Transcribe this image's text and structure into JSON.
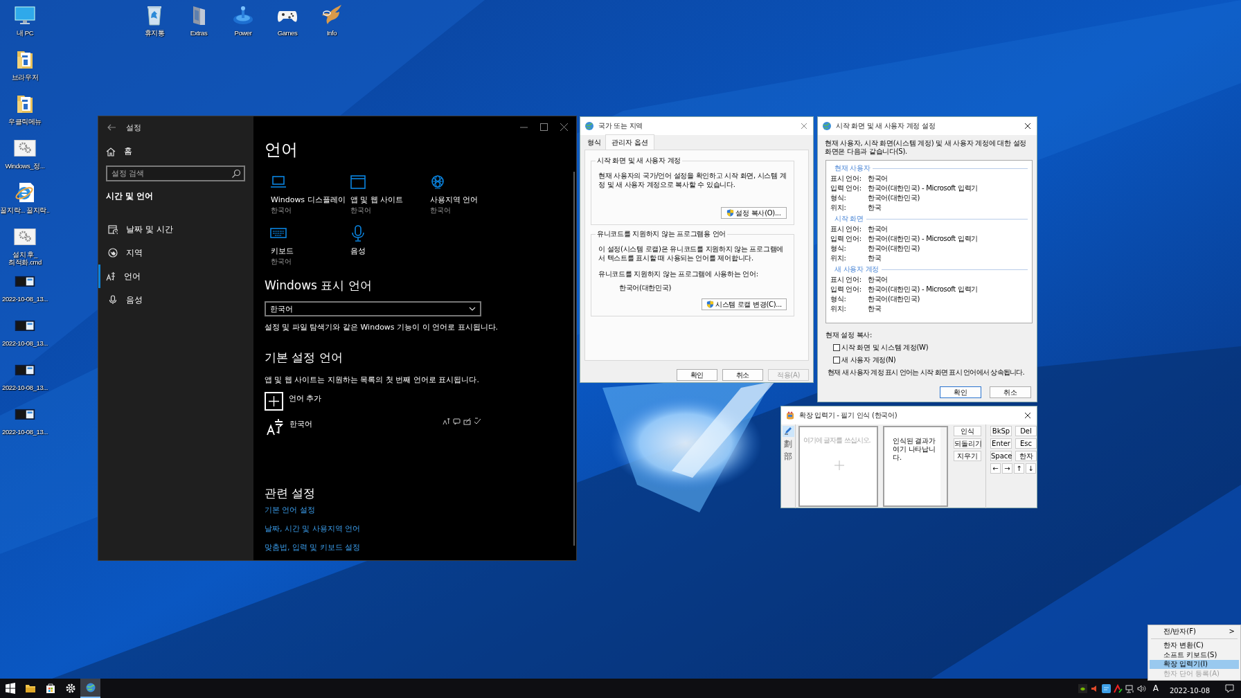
{
  "desktop_column": [
    {
      "label": "내 PC"
    },
    {
      "label": "브라우저"
    },
    {
      "label": "우클릭메뉴"
    },
    {
      "label": "Windows_정..."
    },
    {
      "label": "꿀지락... 꿀지락.."
    },
    {
      "label": "설치 후_최적화.cmd"
    },
    {
      "label": "2022-10-08_13..."
    },
    {
      "label": "2022-10-08_13..."
    },
    {
      "label": "2022-10-08_13..."
    },
    {
      "label": "2022-10-08_13..."
    }
  ],
  "desktop_row": [
    {
      "label": "휴지통"
    },
    {
      "label": "Extras"
    },
    {
      "label": "Power"
    },
    {
      "label": "Games"
    },
    {
      "label": "Info"
    }
  ],
  "settings": {
    "title": "설정",
    "home": "홈",
    "search_placeholder": "설정 검색",
    "section": "시간 및 언어",
    "nav": [
      {
        "label": "날짜 및 시간",
        "selected": false
      },
      {
        "label": "지역",
        "selected": false
      },
      {
        "label": "언어",
        "selected": true
      },
      {
        "label": "음성",
        "selected": false
      }
    ],
    "heading": "언어",
    "tiles": [
      {
        "title": "Windows 디스플레이",
        "subtitle": "한국어"
      },
      {
        "title": "앱 및 웹 사이트",
        "subtitle": "한국어"
      },
      {
        "title": "사용지역 언어",
        "subtitle": "한국어"
      },
      {
        "title": "키보드",
        "subtitle": "한국어"
      },
      {
        "title": "음성"
      }
    ],
    "display_language": {
      "heading": "Windows 표시 언어",
      "value": "한국어",
      "note": "설정 및 파일 탐색기와 같은 Windows 기능이 이 언어로 표시됩니다."
    },
    "preferred": {
      "heading": "기본 설정 언어",
      "note": "앱 및 웹 사이트는 지원하는 목록의 첫 번째 언어로 표시됩니다.",
      "add": "언어 추가",
      "languages": [
        {
          "name": "한국어"
        }
      ]
    },
    "related": {
      "heading": "관련 설정",
      "links": [
        "기본 언어 설정",
        "날짜, 시간 및 사용지역 언어",
        "맞춤법, 입력 및 키보드 설정"
      ]
    }
  },
  "region_dialog": {
    "title": "국가 또는 지역",
    "tabs": [
      {
        "label": "형식",
        "selected": false
      },
      {
        "label": "관리자 옵션",
        "selected": true
      }
    ],
    "groups": [
      {
        "title": "시작 화면 및 새 사용자 계정",
        "text": "현재 사용자의 국가/언어 설정을 확인하고 시작 화면, 시스템 계정 및 새 사용자 계정으로 복사할 수 있습니다.",
        "button": "설정 복사(O)..."
      },
      {
        "title": "유니코드를 지원하지 않는 프로그램용 언어",
        "text": "이 설정(시스템 로캘)은 유니코드를 지원하지 않는 프로그램에서 텍스트를 표시할 때 사용되는 언어를 제어합니다.",
        "label": "유니코드를 지원하지 않는 프로그램에 사용하는 언어:",
        "value": "한국어(대한민국)",
        "button": "시스템 로캘 변경(C)..."
      }
    ],
    "buttons": [
      {
        "label": "확인",
        "disabled": false
      },
      {
        "label": "취소",
        "disabled": false
      },
      {
        "label": "적용(A)",
        "disabled": true
      }
    ]
  },
  "copy_dialog": {
    "title": "시작 화면 및 새 사용자 계정 설정",
    "intro": "현재 사용자, 시작 화면(시스템 계정) 및 새 사용자 계정에 대한 설정 화면은 다음과 같습니다(S).",
    "sections": [
      {
        "title": "현재 사용자",
        "rows": [
          {
            "label": "표시 언어:",
            "value": "한국어"
          },
          {
            "label": "입력 언어:",
            "value": "한국어(대한민국) - Microsoft 입력기"
          },
          {
            "label": "형식:",
            "value": "한국어(대한민국)"
          },
          {
            "label": "위치:",
            "value": "한국"
          }
        ]
      },
      {
        "title": "시작 화면",
        "rows": [
          {
            "label": "표시 언어:",
            "value": "한국어"
          },
          {
            "label": "입력 언어:",
            "value": "한국어(대한민국) - Microsoft 입력기"
          },
          {
            "label": "형식:",
            "value": "한국어(대한민국)"
          },
          {
            "label": "위치:",
            "value": "한국"
          }
        ]
      },
      {
        "title": "새 사용자 계정",
        "rows": [
          {
            "label": "표시 언어:",
            "value": "한국어"
          },
          {
            "label": "입력 언어:",
            "value": "한국어(대한민국) - Microsoft 입력기"
          },
          {
            "label": "형식:",
            "value": "한국어(대한민국)"
          },
          {
            "label": "위치:",
            "value": "한국"
          }
        ]
      }
    ],
    "copy_label": "현재 설정 복사:",
    "checkboxes": [
      {
        "label": "시작 화면 및 시스템 계정(W)",
        "checked": false
      },
      {
        "label": "새 사용자 계정(N)",
        "checked": false
      }
    ],
    "note": "현재 새 사용자 계정 표시 언어는 시작 화면 표시 언어에서 상속됩니다.",
    "buttons": [
      {
        "label": "확인",
        "default": true
      },
      {
        "label": "취소",
        "default": false
      }
    ]
  },
  "handwriting": {
    "title": "확장 입력기 - 필기 인식 (한국어)",
    "modes": [
      {
        "kind": "icon",
        "selected": true
      },
      {
        "kind": "text",
        "label": "劃",
        "selected": false
      },
      {
        "kind": "text",
        "label": "部",
        "selected": false
      }
    ],
    "placeholder": "여기에 글자를 쓰십시오.",
    "result": "인식된 결과가 여기 나타납니다.",
    "actions": [
      "인식",
      "되돌리기",
      "지우기"
    ],
    "keys": [
      "BkSp",
      "Del",
      "Enter",
      "Esc",
      "Space",
      "한자",
      "←",
      "→",
      "↑",
      "↓"
    ]
  },
  "context_menu": [
    {
      "kind": "item",
      "label": "전/반자(F)",
      "arrow": ">",
      "selected": false,
      "disabled": false
    },
    {
      "kind": "separator"
    },
    {
      "kind": "item",
      "label": "한자 변환(C)",
      "selected": false,
      "disabled": false
    },
    {
      "kind": "item",
      "label": "소프트 키보드(S)",
      "selected": false,
      "disabled": false
    },
    {
      "kind": "item",
      "label": "확장 입력기(I)",
      "selected": true,
      "disabled": false
    },
    {
      "kind": "item",
      "label": "한자 단어 등록(A)",
      "selected": false,
      "disabled": true
    }
  ],
  "taskbar": {
    "apps": [
      {
        "selected": false
      },
      {
        "selected": false
      },
      {
        "selected": false
      },
      {
        "selected": false
      },
      {
        "selected": true
      }
    ],
    "ime": "A",
    "date": "2022-10-08"
  }
}
